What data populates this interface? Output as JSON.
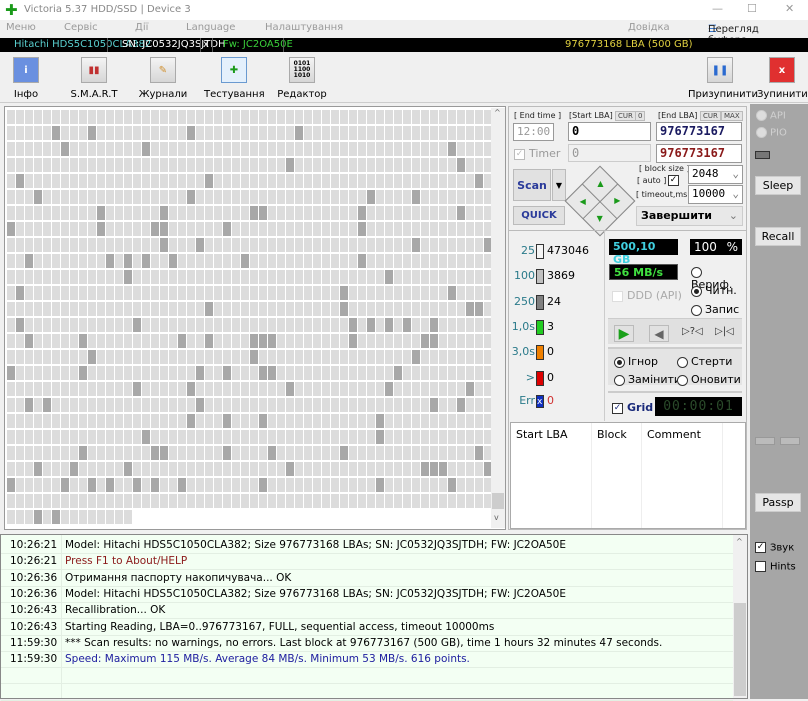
{
  "window": {
    "title": "Victoria 5.37 HDD/SSD | Device 3"
  },
  "menu": {
    "items": [
      "Меню",
      "Сервіс",
      "Дії",
      "Language",
      "Налаштування"
    ],
    "help": "Довідка",
    "buffer": "Перегляд буфера"
  },
  "drive": {
    "model": "Hitachi HDS5C1050CLA382",
    "sn": "SN: JC0532JQ3SJTDH",
    "close": "x",
    "fw": "Fw: JC2OA50E",
    "lba": "976773168 LBA (500 GB)"
  },
  "toolbar": {
    "info": "Інфо",
    "smart": "S.M.A.R.T",
    "logs": "Журнали",
    "test": "Тестування",
    "editor": "Редактор",
    "pause": "Призупинити",
    "stop": "Зупинити"
  },
  "controls": {
    "end_time_label": "[ End time ]",
    "end_time": "12:00",
    "timer_label": "Timer",
    "start_lba_label": "[Start LBA]",
    "cur": "CUR",
    "start_cur_val": "0",
    "start_lba": "0",
    "start_lba2": "0",
    "end_lba_label": "[End LBA]",
    "max": "MAX",
    "end_lba": "976773167",
    "end_lba2": "976773167",
    "scan": "Scan",
    "quick": "QUICK",
    "block_size_label": "[ block size ]",
    "auto_label": "[ auto ]",
    "timeout_label": "[ timeout,ms ]",
    "block_size": "2048",
    "timeout": "10000",
    "finish_action": "Завершити"
  },
  "stats": [
    {
      "key": "25",
      "count": "473046",
      "color": "#f4f4f4"
    },
    {
      "key": "100",
      "count": "3869",
      "color": "#c0c0c0"
    },
    {
      "key": "250",
      "count": "24",
      "color": "#808080"
    },
    {
      "key": "1,0s",
      "count": "3",
      "color": "#22cc22"
    },
    {
      "key": "3,0s",
      "count": "0",
      "color": "#f08000"
    },
    {
      "key": ">",
      "count": "0",
      "color": "#dd0000"
    },
    {
      "key": "Err",
      "count": "0",
      "color": "#1030c0"
    }
  ],
  "status": {
    "capacity": "500,10 GB",
    "percent": "100",
    "percent_sign": "%",
    "speed": "56 MB/s",
    "ddd": "DDD (API)",
    "verify": "Вериф.",
    "read": "Читн.",
    "write": "Запис",
    "ignore": "Ігнор",
    "erase": "Стерти",
    "remap": "Замінити",
    "refresh": "Оновити",
    "grid": "Grid",
    "elapsed": "00:00:01"
  },
  "table": {
    "columns": [
      "Start LBA",
      "Block",
      "Comment"
    ]
  },
  "side": {
    "api": "API",
    "pio": "PIO",
    "sleep": "Sleep",
    "recall": "Recall",
    "passp": "Passp",
    "sound": "Звук",
    "hints": "Hints"
  },
  "log": [
    {
      "time": "10:26:21",
      "msg": "Model: Hitachi HDS5C1050CLA382; Size 976773168 LBAs; SN: JC0532JQ3SJTDH; FW: JC2OA50E",
      "color": "#000000"
    },
    {
      "time": "10:26:21",
      "msg": "Press F1 to About/HELP",
      "color": "#8b1a1a"
    },
    {
      "time": "10:26:36",
      "msg": "Отримання паспорту накопичувача... OK",
      "color": "#000000"
    },
    {
      "time": "10:26:36",
      "msg": "Model: Hitachi HDS5C1050CLA382; Size 976773168 LBAs; SN: JC0532JQ3SJTDH; FW: JC2OA50E",
      "color": "#000000"
    },
    {
      "time": "10:26:43",
      "msg": "Recallibration... OK",
      "color": "#000000"
    },
    {
      "time": "10:26:43",
      "msg": "Starting Reading, LBA=0..976773167, FULL, sequential access, timeout 10000ms",
      "color": "#000000"
    },
    {
      "time": "11:59:30",
      "msg": "*** Scan results: no warnings, no errors. Last block at 976773167 (500 GB), time 1 hours 32 minutes 47 seconds.",
      "color": "#000000"
    },
    {
      "time": "11:59:30",
      "msg": "Speed: Maximum 115 MB/s. Average 84 MB/s. Minimum 53 MB/s. 616 points.",
      "color": "#2020a0"
    }
  ]
}
